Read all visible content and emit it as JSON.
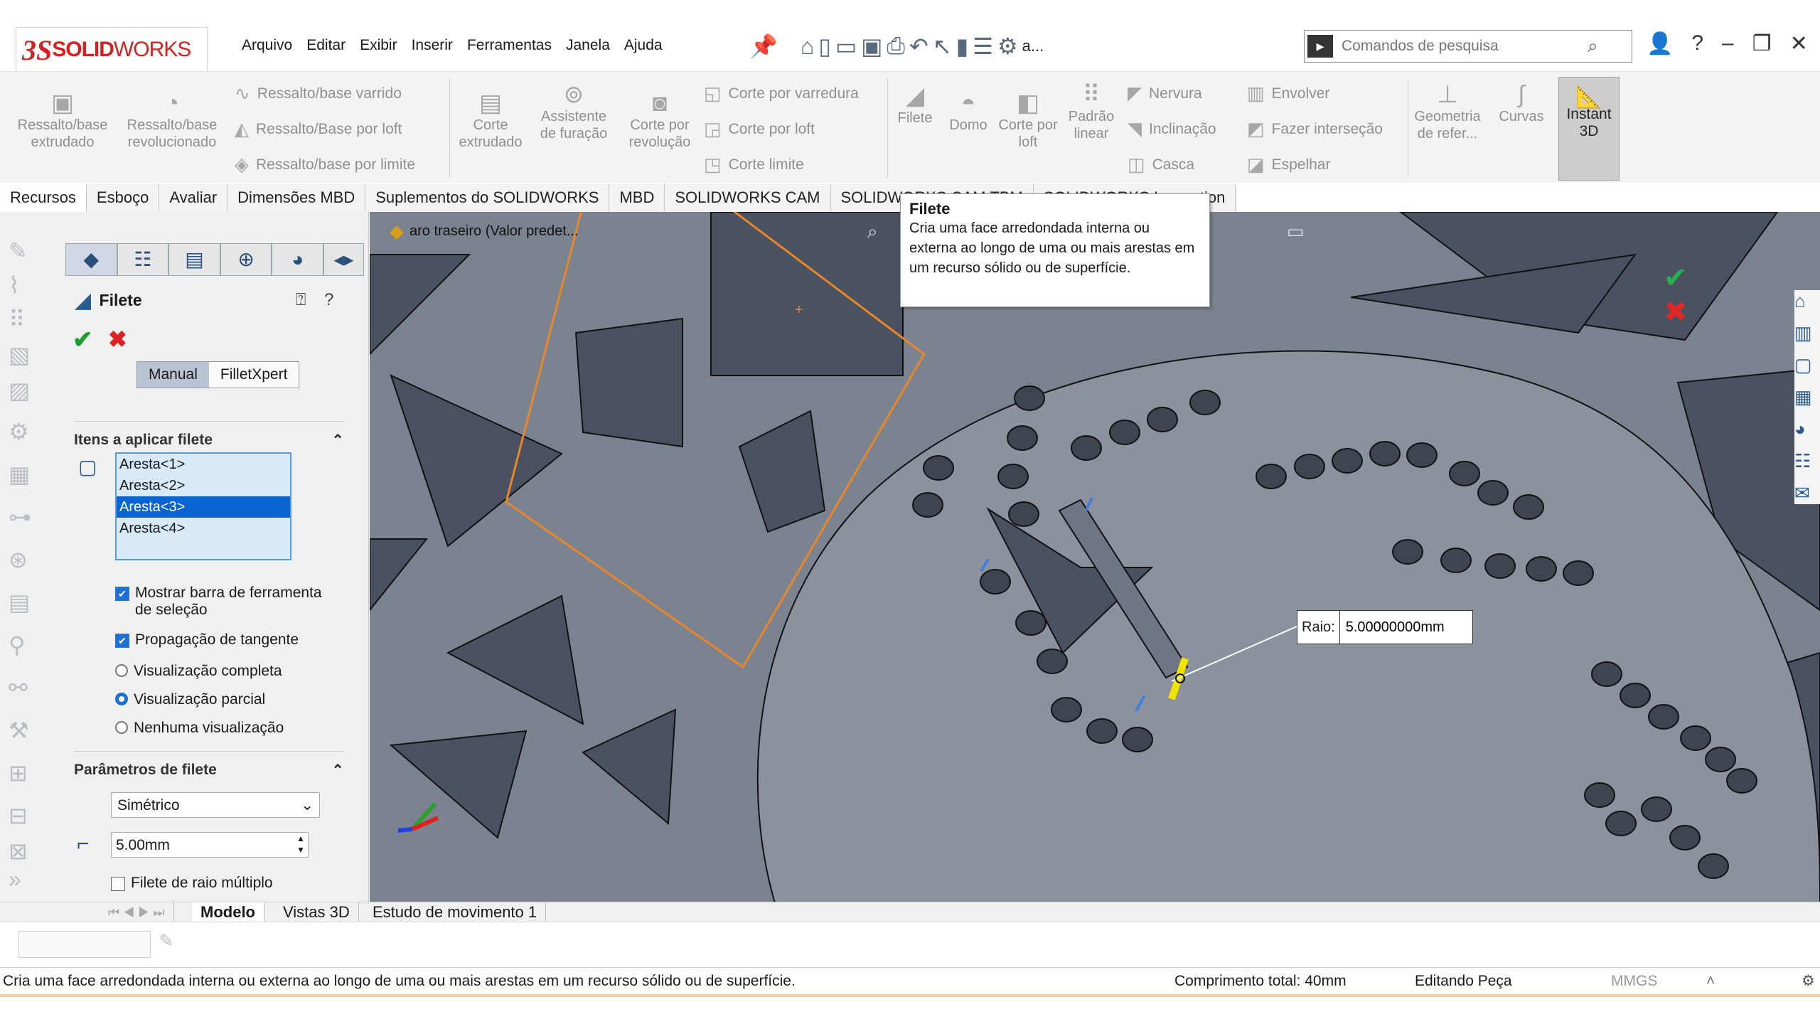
{
  "app": {
    "brand_ds": "3S",
    "brand_solid": "SOLID",
    "brand_works": "WORKS"
  },
  "menu": [
    "Arquivo",
    "Editar",
    "Exibir",
    "Inserir",
    "Ferramentas",
    "Janela",
    "Ajuda"
  ],
  "toolbar_more": "a...",
  "search": {
    "placeholder": "Comandos de pesquisa"
  },
  "ribbon": {
    "big": [
      {
        "label": "Ressalto/base extrudado"
      },
      {
        "label": "Ressalto/base revolucionado"
      },
      {
        "label": "Corte extrudado"
      },
      {
        "label": "Assistente de furação"
      },
      {
        "label": "Corte por revolução"
      },
      {
        "label": "Filete"
      },
      {
        "label": "Domo"
      },
      {
        "label": "Corte por loft"
      },
      {
        "label": "Padrão linear"
      },
      {
        "label": "Geometria de refer..."
      },
      {
        "label": "Curvas"
      },
      {
        "label": "Instant 3D"
      }
    ],
    "small": [
      "Ressalto/base varrido",
      "Ressalto/Base por loft",
      "Ressalto/base por limite",
      "Corte por varredura",
      "Corte por loft",
      "Corte limite",
      "Nervura",
      "Inclinação",
      "Casca",
      "Envolver",
      "Fazer interseção",
      "Espelhar"
    ]
  },
  "tabs": [
    "Recursos",
    "Esboço",
    "Avaliar",
    "Dimensões MBD",
    "Suplementos do SOLIDWORKS",
    "MBD",
    "SOLIDWORKS CAM",
    "SOLIDWORKS CAM TBM",
    "SOLIDWORKS Inspection"
  ],
  "tree_item": "aro traseiro  (Valor predet...",
  "pm": {
    "title": "Filete",
    "mode_manual": "Manual",
    "mode_expert": "FilletXpert",
    "items_header": "Itens a aplicar filete",
    "edges": [
      "Aresta<1>",
      "Aresta<2>",
      "Aresta<3>",
      "Aresta<4>"
    ],
    "selected_edge": "Aresta<3>",
    "opt_show_toolbar": "Mostrar barra de ferramenta de seleção",
    "opt_tangent": "Propagação de tangente",
    "opt_full": "Visualização completa",
    "opt_partial": "Visualização parcial",
    "opt_none": "Nenhuma visualização",
    "params_header": "Parâmetros de filete",
    "profile": "Simétrico",
    "radius": "5.00mm",
    "multi_radius": "Filete de raio múltiplo"
  },
  "tooltip": {
    "title": "Filete",
    "text": "Cria uma face arredondada interna ou externa ao longo de uma ou mais arestas em um recurso sólido ou de superfície."
  },
  "callout": {
    "label": "Raio:",
    "value": "5.00000000mm"
  },
  "bottom_tabs": [
    "Modelo",
    "Vistas 3D",
    "Estudo de movimento 1"
  ],
  "status": {
    "message": "Cria uma face arredondada interna ou externa ao longo de uma ou mais arestas em um recurso sólido ou de superfície.",
    "length": "Comprimento total: 40mm",
    "mode": "Editando Peça",
    "units": "MMGS"
  },
  "colors": {
    "accent": "#d62020",
    "viewport_bg": "#7b8391",
    "selection": "#0a63d1",
    "sketch_orange": "#e8862a",
    "highlight": "#f2e600"
  }
}
